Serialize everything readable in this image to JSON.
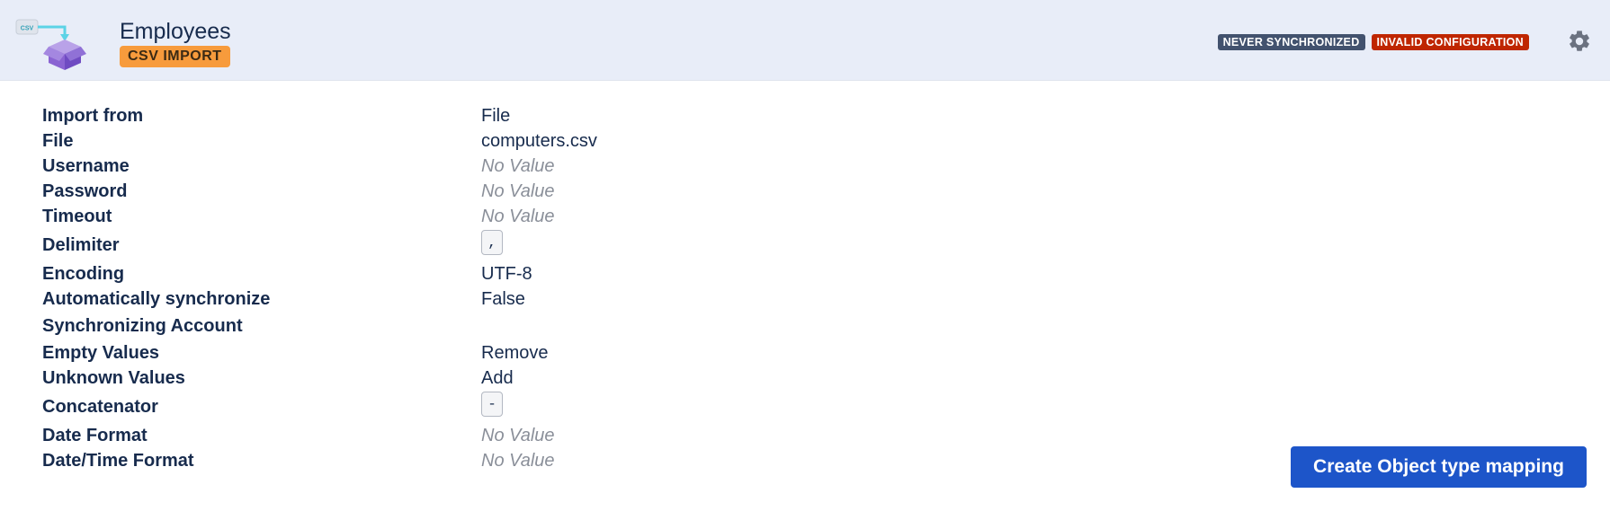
{
  "header": {
    "logo_icon": "csv-import-box-icon",
    "logo_label": "CSV",
    "title": "Employees",
    "type_badge": "CSV IMPORT",
    "statuses": {
      "never_synchronized": "NEVER SYNCHRONIZED",
      "invalid_configuration": "INVALID CONFIGURATION"
    },
    "settings_icon": "gear-icon"
  },
  "details": {
    "import_from": {
      "label": "Import from",
      "value": "File"
    },
    "file": {
      "label": "File",
      "value": "computers.csv"
    },
    "username": {
      "label": "Username",
      "value": "No Value"
    },
    "password": {
      "label": "Password",
      "value": "No Value"
    },
    "timeout": {
      "label": "Timeout",
      "value": "No Value"
    },
    "delimiter": {
      "label": "Delimiter",
      "value": ","
    },
    "encoding": {
      "label": "Encoding",
      "value": "UTF-8"
    },
    "auto_sync": {
      "label": "Automatically synchronize",
      "value": "False"
    },
    "sync_account": {
      "label": "Synchronizing Account",
      "value": ""
    },
    "empty_values": {
      "label": "Empty Values",
      "value": "Remove"
    },
    "unknown_values": {
      "label": "Unknown Values",
      "value": "Add"
    },
    "concatenator": {
      "label": "Concatenator",
      "value": "-"
    },
    "date_format": {
      "label": "Date Format",
      "value": "No Value"
    },
    "datetime_format": {
      "label": "Date/Time Format",
      "value": "No Value"
    }
  },
  "actions": {
    "create_mapping": "Create Object type mapping"
  },
  "colors": {
    "header_bg": "#e8edf8",
    "csv_badge": "#f79b3c",
    "status_never": "#42526e",
    "status_invalid": "#bf2600",
    "primary_button": "#1d55c9",
    "no_value_text": "#8a8f99"
  }
}
